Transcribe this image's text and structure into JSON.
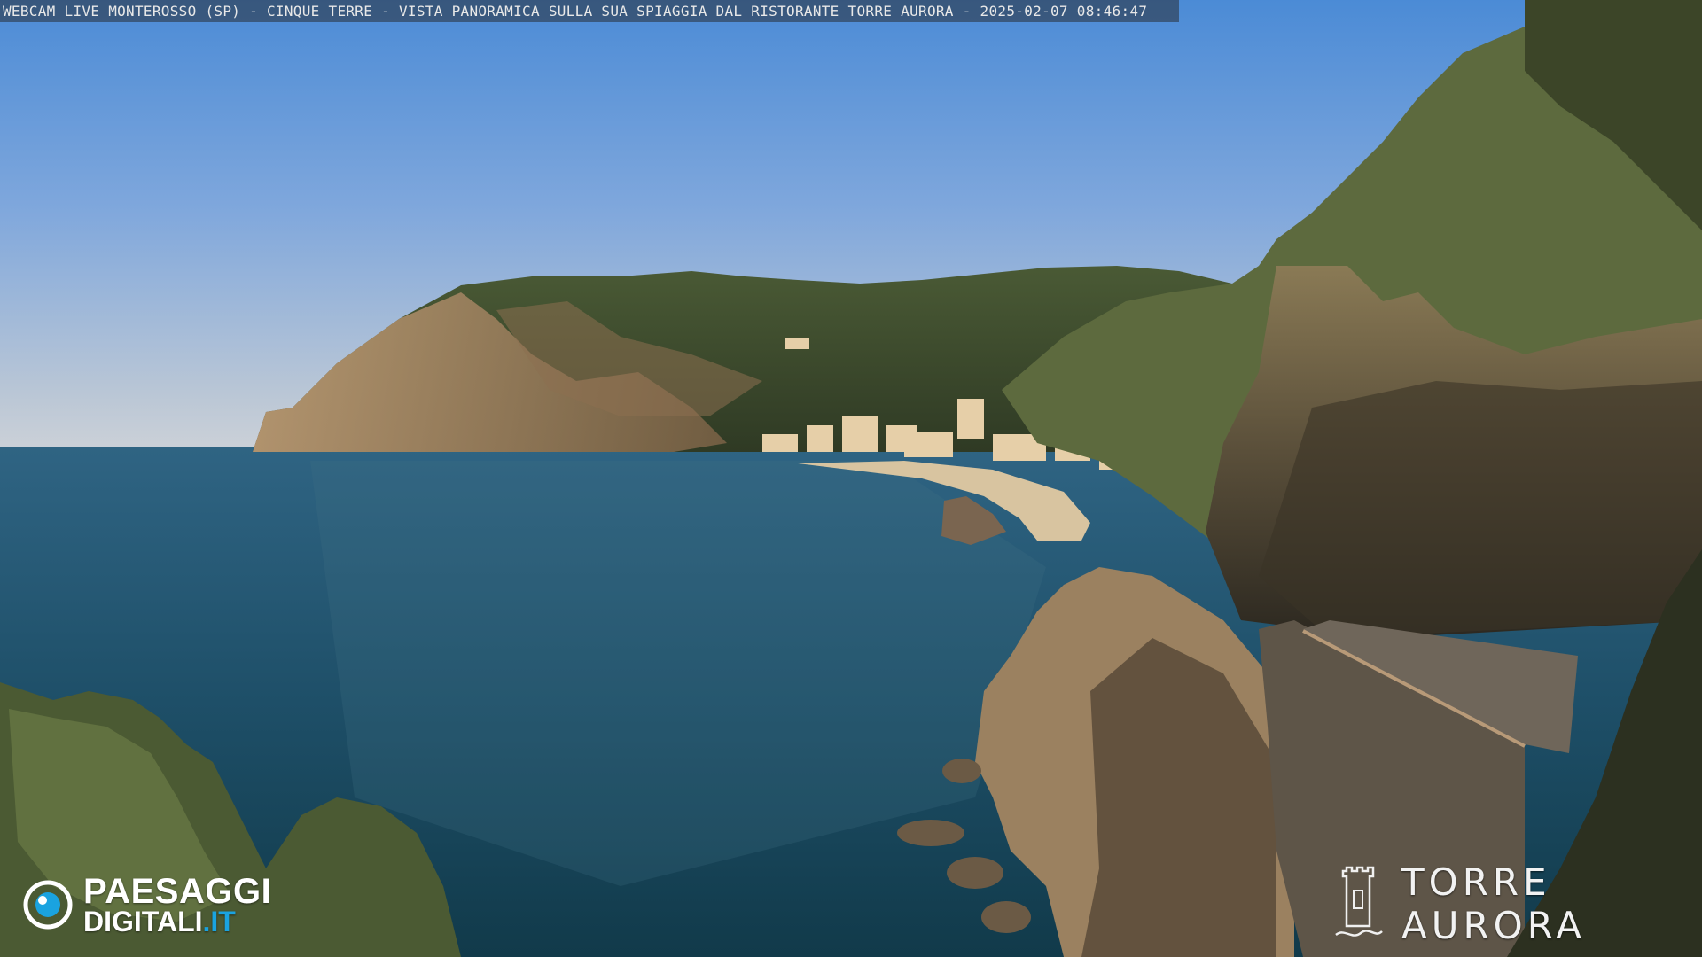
{
  "caption": "WEBCAM LIVE MONTEROSSO (SP) - CINQUE TERRE - VISTA PANORAMICA SULLA SUA SPIAGGIA DAL RISTORANTE TORRE AURORA - 2025-02-07 08:46:47",
  "logo_left": {
    "line1": "PAESAGGI",
    "line2_white": "DIGITALI",
    "line2_blue": ".IT",
    "icon": "eye-icon",
    "accent_color": "#1aa3e0"
  },
  "logo_right": {
    "text": "TORRE AURORA",
    "icon": "tower-icon"
  },
  "colors": {
    "sky_top": "#4d8fd9",
    "sky_horizon": "#c4ccd6",
    "sea": "#1d4a63",
    "headland": "#3f5230",
    "cliff": "#a07a55"
  }
}
